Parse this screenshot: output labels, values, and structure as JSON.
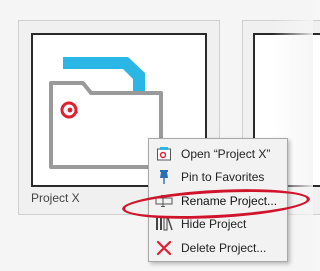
{
  "project_tile": {
    "label": "Project X"
  },
  "context_menu": {
    "items": [
      {
        "label": "Open “Project X”",
        "icon": "open-project-icon"
      },
      {
        "label": "Pin to Favorites",
        "icon": "pin-icon"
      },
      {
        "label": "Rename Project...",
        "icon": "rename-icon",
        "highlighted": true
      },
      {
        "label": "Hide Project",
        "icon": "hide-icon"
      },
      {
        "label": "Delete Project...",
        "icon": "delete-icon"
      }
    ]
  },
  "colors": {
    "folder_tab": "#2bb7e6",
    "folder_outline": "#9a9a9a",
    "brand_red": "#e0202e",
    "callout": "#d0142b"
  }
}
